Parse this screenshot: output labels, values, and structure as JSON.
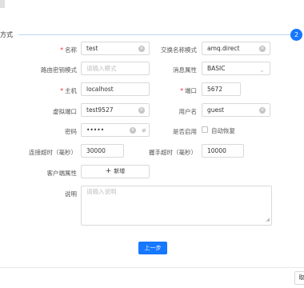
{
  "step": {
    "title": "方式",
    "number": "2",
    "accent": "#1677ff"
  },
  "form": {
    "name": {
      "label": "名称",
      "value": "test",
      "required": true
    },
    "exchange": {
      "label": "交换名称模式",
      "value": "amq.direct"
    },
    "routing": {
      "label": "路由密钥模式",
      "placeholder": "请输入模式"
    },
    "msg_attr": {
      "label": "消息属性",
      "value": "BASIC"
    },
    "host": {
      "label": "主机",
      "value": "localhost",
      "required": true
    },
    "port": {
      "label": "端口",
      "value": "5672",
      "required": true
    },
    "vhost": {
      "label": "虚拟端口",
      "value": "test9527"
    },
    "username": {
      "label": "用户名",
      "value": "guest"
    },
    "password": {
      "label": "密码",
      "value": "•••••"
    },
    "enable": {
      "label": "是否启用",
      "checkbox_label": "自动恢复"
    },
    "conn_timeout": {
      "label": "连接超时（毫秒）",
      "value": "30000"
    },
    "handshake_timeout": {
      "label": "握手超时（毫秒）",
      "value": "10000"
    },
    "client_props": {
      "label": "客户端属性",
      "add_label": "新增"
    },
    "desc": {
      "label": "说明",
      "placeholder": "请输入说明"
    }
  },
  "footer": {
    "prev_label": "上一步",
    "right_label": "取"
  }
}
